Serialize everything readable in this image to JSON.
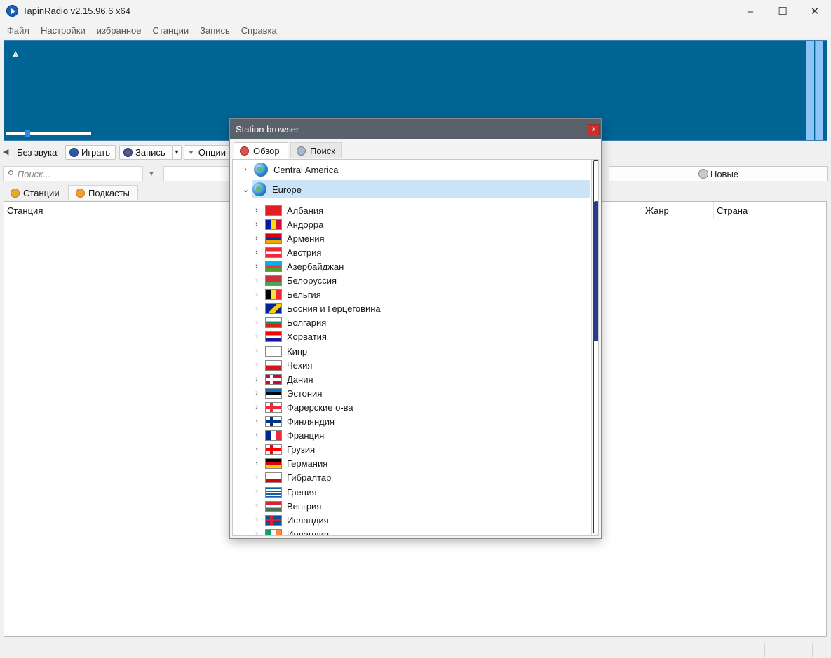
{
  "window": {
    "title": "TapinRadio v2.15.96.6   x64",
    "minimize": "–",
    "maximize": "☐",
    "close": "✕"
  },
  "menu": [
    "Файл",
    "Настройки",
    "избранное",
    "Станции",
    "Запись",
    "Справка"
  ],
  "toolbar": {
    "mute": "Без звука",
    "play": "Играть",
    "record": "Запись",
    "record_dropdown": "▾",
    "options": "Опции"
  },
  "search": {
    "placeholder": "Поиск..."
  },
  "new_button": "Новые",
  "tabs": [
    "Станции",
    "Подкасты"
  ],
  "columns": {
    "station": "Станция",
    "genre": "Жанр",
    "country": "Страна"
  },
  "volume_level": 0.23,
  "modal": {
    "title": "Station browser",
    "close": "x",
    "tabs": [
      "Обзор",
      "Поиск"
    ],
    "regions": [
      {
        "label": "Central America",
        "expanded": false
      },
      {
        "label": "Europe",
        "expanded": true
      }
    ],
    "countries": [
      {
        "label": "Албания",
        "flag": "albania"
      },
      {
        "label": "Андорра",
        "flag": "andorra"
      },
      {
        "label": "Армения",
        "flag": "armenia"
      },
      {
        "label": "Австрия",
        "flag": "austria"
      },
      {
        "label": "Азербайджан",
        "flag": "azerbaijan"
      },
      {
        "label": "Белоруссия",
        "flag": "belarus"
      },
      {
        "label": "Бельгия",
        "flag": "belgium"
      },
      {
        "label": "Босния и Герцеговина",
        "flag": "bosnia"
      },
      {
        "label": "Болгария",
        "flag": "bulgaria"
      },
      {
        "label": "Хорватия",
        "flag": "croatia"
      },
      {
        "label": "Кипр",
        "flag": "cyprus"
      },
      {
        "label": "Чехия",
        "flag": "czechia"
      },
      {
        "label": "Дания",
        "flag": "denmark"
      },
      {
        "label": "Эстония",
        "flag": "estonia"
      },
      {
        "label": "Фарерские о-ва",
        "flag": "faroe"
      },
      {
        "label": "Финляндия",
        "flag": "finland"
      },
      {
        "label": "Франция",
        "flag": "france"
      },
      {
        "label": "Грузия",
        "flag": "georgia"
      },
      {
        "label": "Германия",
        "flag": "germany"
      },
      {
        "label": "Гибралтар",
        "flag": "gibraltar"
      },
      {
        "label": "Греция",
        "flag": "greece"
      },
      {
        "label": "Венгрия",
        "flag": "hungary"
      },
      {
        "label": "Исландия",
        "flag": "iceland"
      },
      {
        "label": "Ирландия",
        "flag": "ireland"
      }
    ]
  },
  "colors": {
    "display_bg": "#006494",
    "accent": "#2c8ae8",
    "selection": "#cce4f7",
    "scroll_thumb": "#2b3a8e"
  }
}
